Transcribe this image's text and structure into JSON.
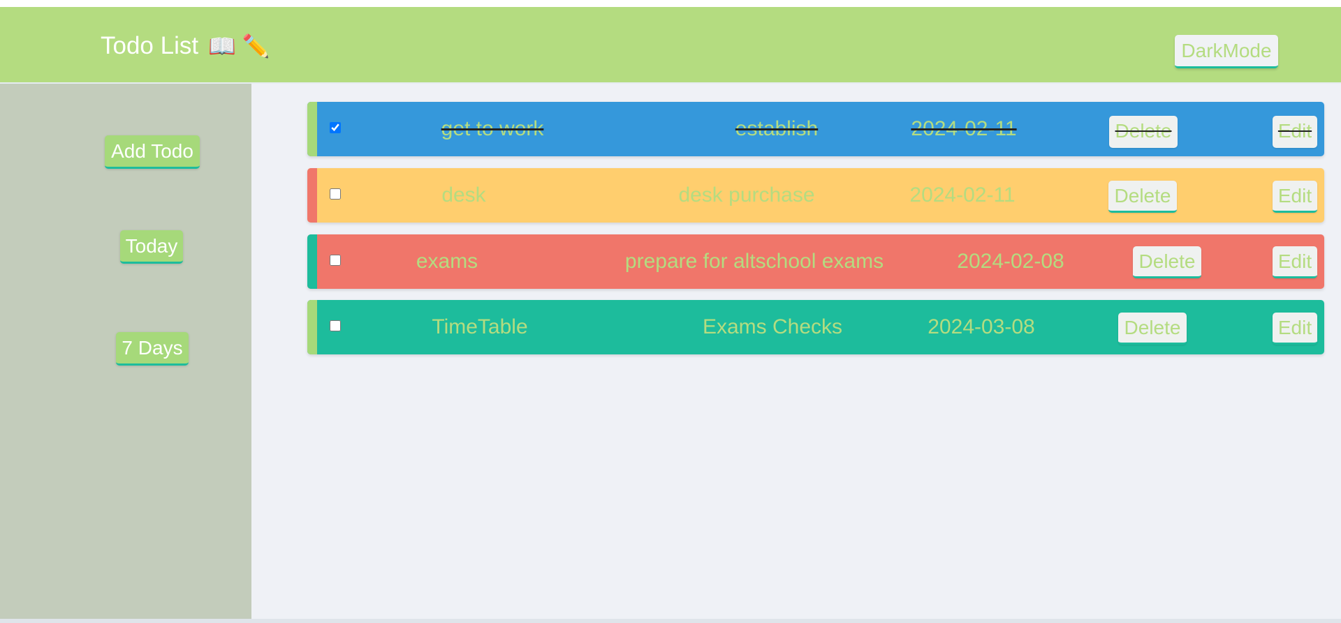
{
  "header": {
    "title": "Todo List",
    "title_icons": "📖 ✏️",
    "darkmode_label": "DarkMode"
  },
  "sidebar": {
    "add_todo_label": "Add Todo",
    "today_label": "Today",
    "seven_days_label": "7 Days"
  },
  "todos": [
    {
      "title": "get to work",
      "details": "establish",
      "date": "2024-02-11",
      "checked": true,
      "background": "#3598db",
      "stripe": "#a6d97a",
      "delete_label": "Delete",
      "edit_label": "Edit"
    },
    {
      "title": "desk",
      "details": "desk purchase",
      "date": "2024-02-11",
      "checked": false,
      "background": "#ffce6e",
      "stripe": "#f0766a",
      "delete_label": "Delete",
      "edit_label": "Edit"
    },
    {
      "title": "exams",
      "details": "prepare for altschool exams",
      "date": "2024-02-08",
      "checked": false,
      "background": "#f0766a",
      "stripe": "#1dbc9c",
      "delete_label": "Delete",
      "edit_label": "Edit"
    },
    {
      "title": "TimeTable",
      "details": "Exams Checks",
      "date": "2024-03-08",
      "checked": false,
      "background": "#1dbc9c",
      "stripe": "#a6d97a",
      "delete_label": "Delete",
      "edit_label": "Edit"
    }
  ],
  "colors": {
    "header_bg": "#b4dc80",
    "sidebar_bg": "#c3ccbb",
    "main_bg": "#eff1f6",
    "accent_text": "#b4dc80",
    "button_underline": "#1dbc9c"
  }
}
